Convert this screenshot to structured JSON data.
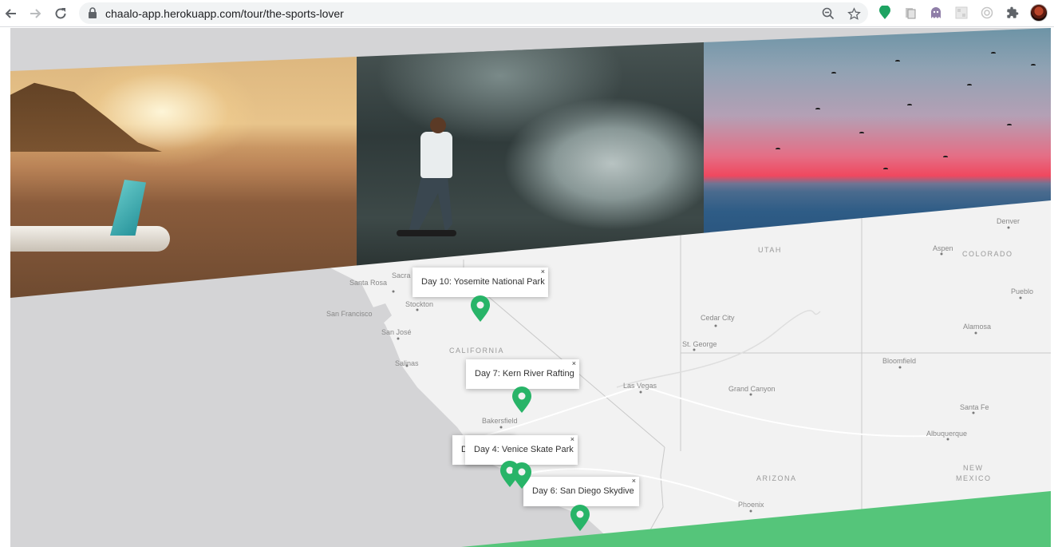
{
  "browser": {
    "url": "chaalo-app.herokuapp.com/tour/the-sports-lover",
    "nav": {
      "back": "back-arrow-icon",
      "forward": "forward-arrow-icon",
      "reload": "reload-icon"
    },
    "omnibox_icons": [
      "zoom-icon",
      "star-icon"
    ],
    "extensions": [
      "green-pin-extension-icon",
      "document-extension-icon",
      "ghost-extension-icon",
      "qr-extension-icon",
      "timer-extension-icon",
      "puzzle-icon"
    ]
  },
  "hero": {
    "photos": [
      "beach-surfboard-photo",
      "skatepark-photo",
      "sunset-sea-photo"
    ]
  },
  "map": {
    "labels": {
      "santa_rosa": "Santa Rosa",
      "sacramento": "Sacra",
      "stockton": "Stockton",
      "san_francisco": "San Francisco",
      "san_jose": "San José",
      "california": "CALIFORNIA",
      "salinas": "Salinas",
      "bakersfield": "Bakersfield",
      "las_vegas": "Las Vegas",
      "cedar_city": "Cedar City",
      "st_george": "St. George",
      "utah": "UTAH",
      "aspen": "Aspen",
      "colorado": "COLORADO",
      "denver": "Denver",
      "pueblo": "Pueblo",
      "alamosa": "Alamosa",
      "bloomfield": "Bloomfield",
      "grand_canyon": "Grand Canyon",
      "santa_fe": "Santa Fe",
      "albuquerque": "Albuquerque",
      "new": "NEW",
      "mexico": "MEXICO",
      "arizona": "ARIZONA",
      "phoenix": "Phoenix"
    },
    "popups": [
      {
        "label": "Day 10: Yosemite National Park",
        "close": "×"
      },
      {
        "label": "Day 7: Kern River Rafting",
        "close": "×"
      },
      {
        "label": "Day 4: Venice Skate Park",
        "close": "×"
      },
      {
        "label": "Day 6: San Diego Skydive",
        "close": "×"
      },
      {
        "label": "D",
        "close": ""
      }
    ],
    "pin_color": "#28b468",
    "land_color": "#f2f2f2",
    "water_color": "#d4d4d6"
  },
  "accent_color": "#55c57a"
}
